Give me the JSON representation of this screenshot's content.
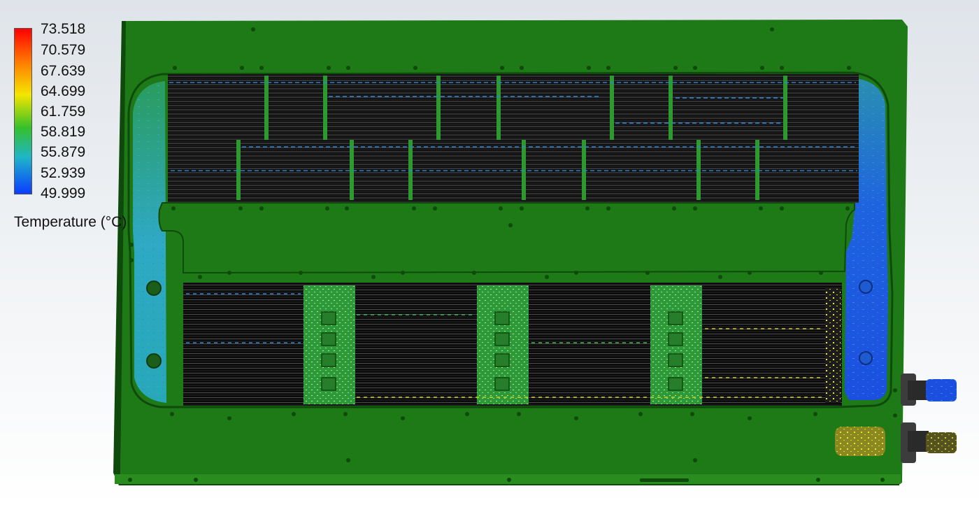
{
  "legend": {
    "title": "Temperature (°C)",
    "ticks": [
      "73.518",
      "70.579",
      "67.639",
      "64.699",
      "61.759",
      "58.819",
      "55.879",
      "52.939",
      "49.999"
    ],
    "gradient_colors": [
      "#ff0000",
      "#ff7a00",
      "#f5e600",
      "#35c02a",
      "#1fb5c8",
      "#0a3cff"
    ]
  },
  "model": {
    "plate_color": "#1e7a16",
    "plate_dark": "#0f4a0c",
    "fin_color": "#111111",
    "coolant_inlet_color": "#1c4fe0",
    "coolant_outlet_color": "#e3e022"
  }
}
